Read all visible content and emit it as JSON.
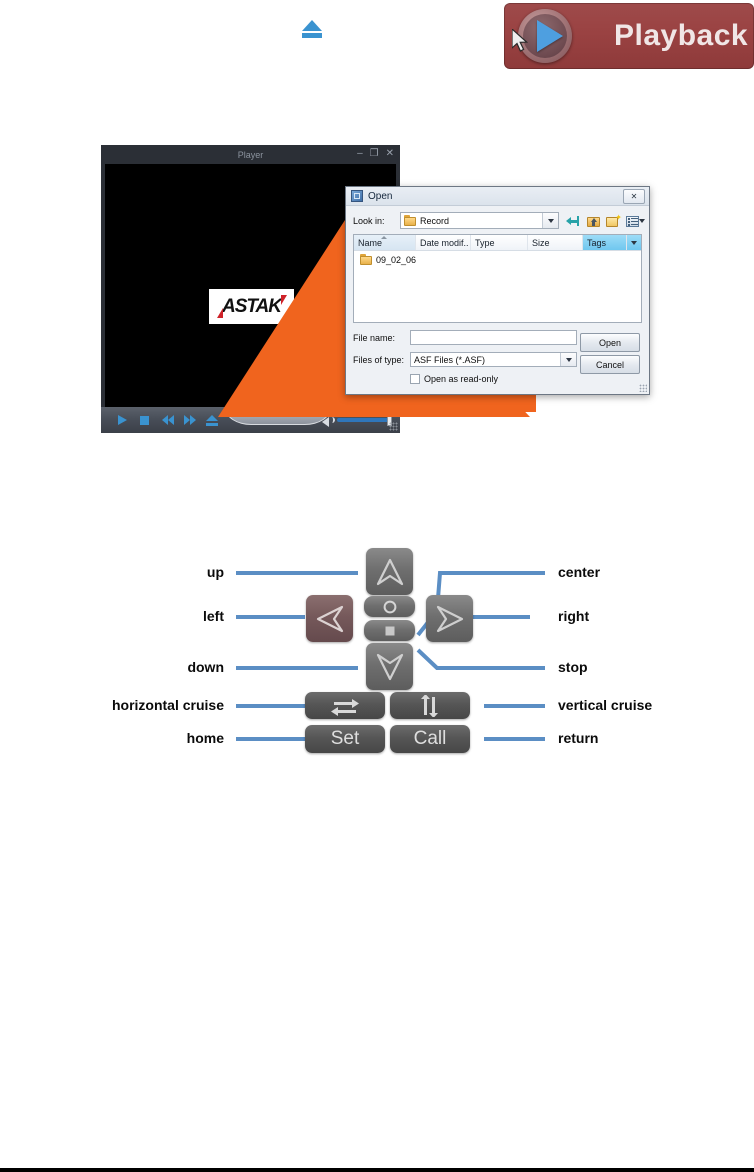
{
  "page": {
    "eject_icon_name": "eject-icon"
  },
  "playback_badge": {
    "label": "Playback",
    "icon": "play-circle-icon",
    "cursor_icon": "mouse-cursor-icon",
    "bg_color": "#9a4242",
    "text_color": "#f0e6e6",
    "play_triangle_color": "#4e9fe0"
  },
  "player_window": {
    "title": "Player",
    "window_buttons": [
      "–",
      "❐",
      "✕"
    ],
    "logo_text": "ASTAK",
    "video_bg": "#000000",
    "controls": {
      "play": "play-icon",
      "stop": "stop-icon",
      "rewind": "rewind-icon",
      "fast_forward": "fast-forward-icon",
      "eject": "eject-icon",
      "volume_icon": "volume-icon",
      "volume_level": 100
    }
  },
  "open_dialog": {
    "title": "Open",
    "close_label": "✕",
    "look_in_label": "Look in:",
    "look_in_value": "Record",
    "toolbar": [
      "back-icon",
      "up-folder-icon",
      "new-folder-icon",
      "views-icon"
    ],
    "columns": [
      "Name",
      "Date modif..",
      "Type",
      "Size",
      "Tags"
    ],
    "files": [
      {
        "name": "09_02_06",
        "icon": "folder-icon"
      }
    ],
    "file_name_label": "File name:",
    "file_name_value": "",
    "files_of_type_label": "Files of type:",
    "files_of_type_value": "ASF Files (*.ASF)",
    "read_only_label": "Open as read-only",
    "read_only_checked": false,
    "open_button": "Open",
    "cancel_button": "Cancel",
    "tags_header_color": "#6fc7ef"
  },
  "callout": {
    "color": "#f0641e"
  },
  "ptz_diagram": {
    "labels_left": [
      {
        "text": "up",
        "target": "up-button"
      },
      {
        "text": "left",
        "target": "left-button"
      },
      {
        "text": "down",
        "target": "down-button"
      },
      {
        "text": "horizontal cruise",
        "target": "horizontal-cruise-button"
      },
      {
        "text": "home",
        "target": "set-button"
      }
    ],
    "labels_right": [
      {
        "text": "center",
        "target": "center-button"
      },
      {
        "text": "right",
        "target": "right-button"
      },
      {
        "text": "stop",
        "target": "stop-button"
      },
      {
        "text": "vertical cruise",
        "target": "vertical-cruise-button"
      },
      {
        "text": "return",
        "target": "call-button"
      }
    ],
    "buttons": {
      "up": "up-arrow-icon",
      "down": "down-arrow-icon",
      "left": "left-arrow-icon",
      "right": "right-arrow-icon",
      "center": "circle-icon",
      "stop": "square-icon",
      "horizontal_cruise": "horizontal-arrows-icon",
      "vertical_cruise": "vertical-arrows-icon",
      "set": "Set",
      "call": "Call"
    },
    "leader_line_color": "#5b8ec4"
  }
}
